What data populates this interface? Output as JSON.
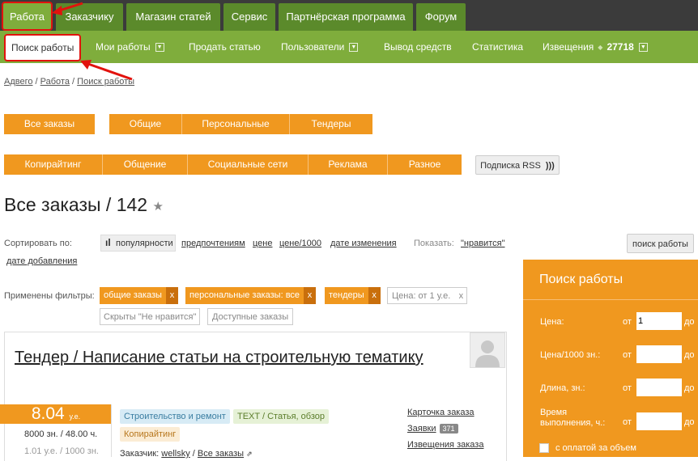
{
  "top_nav": [
    "Работа",
    "Заказчику",
    "Магазин статей",
    "Сервис",
    "Партнёрская программа",
    "Форум"
  ],
  "sub_nav": {
    "search": "Поиск работы",
    "my_works": "Мои работы",
    "sell": "Продать статью",
    "users": "Пользователи",
    "withdraw": "Вывод средств",
    "stats": "Статистика",
    "notifications": "Извещения",
    "notif_count": "27718"
  },
  "breadcrumb": {
    "home": "Адвего",
    "sep": "/",
    "work": "Работа",
    "current": "Поиск работы"
  },
  "order_buttons": [
    "Все заказы",
    "Общие",
    "Персональные",
    "Тендеры"
  ],
  "category_buttons": [
    "Копирайтинг",
    "Общение",
    "Социальные сети",
    "Реклама",
    "Разное"
  ],
  "rss_label": "Подписка RSS",
  "page_title": "Все заказы / 142",
  "sort": {
    "label": "Сортировать по:",
    "popularity": "популярности",
    "preferences": "предпочтениям",
    "price": "цене",
    "price_per_1000": "цене/1000",
    "change_date": "дате изменения",
    "show_label": "Показать:",
    "liked": "\"нравится\"",
    "added_date": "дате добавления"
  },
  "search_button": "поиск работы",
  "filters": {
    "label": "Применены фильтры:",
    "general": "общие заказы",
    "personal": "персональные заказы: все",
    "tenders": "тендеры",
    "price": "Цена: от 1 у.е.",
    "hidden": "Скрыты \"Не нравится\"",
    "available": "Доступные заказы"
  },
  "order": {
    "title": "Тендер / Написание статьи на строительную тематику",
    "price": "8.04",
    "currency": "у.е.",
    "meta1": "8000 зн. / 48.00 ч.",
    "meta2": "1.01 у.е. / 1000 зн.",
    "tags": [
      "Строительство и ремонт",
      "TEXT / Статья, обзор",
      "Копирайтинг"
    ],
    "customer_label": "Заказчик:",
    "customer_name": "wellsky",
    "customer_all": "Все заказы",
    "link_card": "Карточка заказа",
    "link_applications": "Заявки",
    "applications_count": "371",
    "link_notifications": "Извещения заказа"
  },
  "panel": {
    "title": "Поиск работы",
    "price_label": "Цена:",
    "price_per_1000_label": "Цена/1000 зн.:",
    "length_label": "Длина, зн.:",
    "time_label_1": "Время",
    "time_label_2": "выполнения, ч.:",
    "from": "от",
    "to": "до",
    "price_value": "1",
    "volume_pay": "с оплатой за объем"
  },
  "colors": {
    "green_dark": "#5b8a2b",
    "green": "#7fad3c",
    "orange": "#f0981f",
    "highlight": "#e2120d"
  }
}
